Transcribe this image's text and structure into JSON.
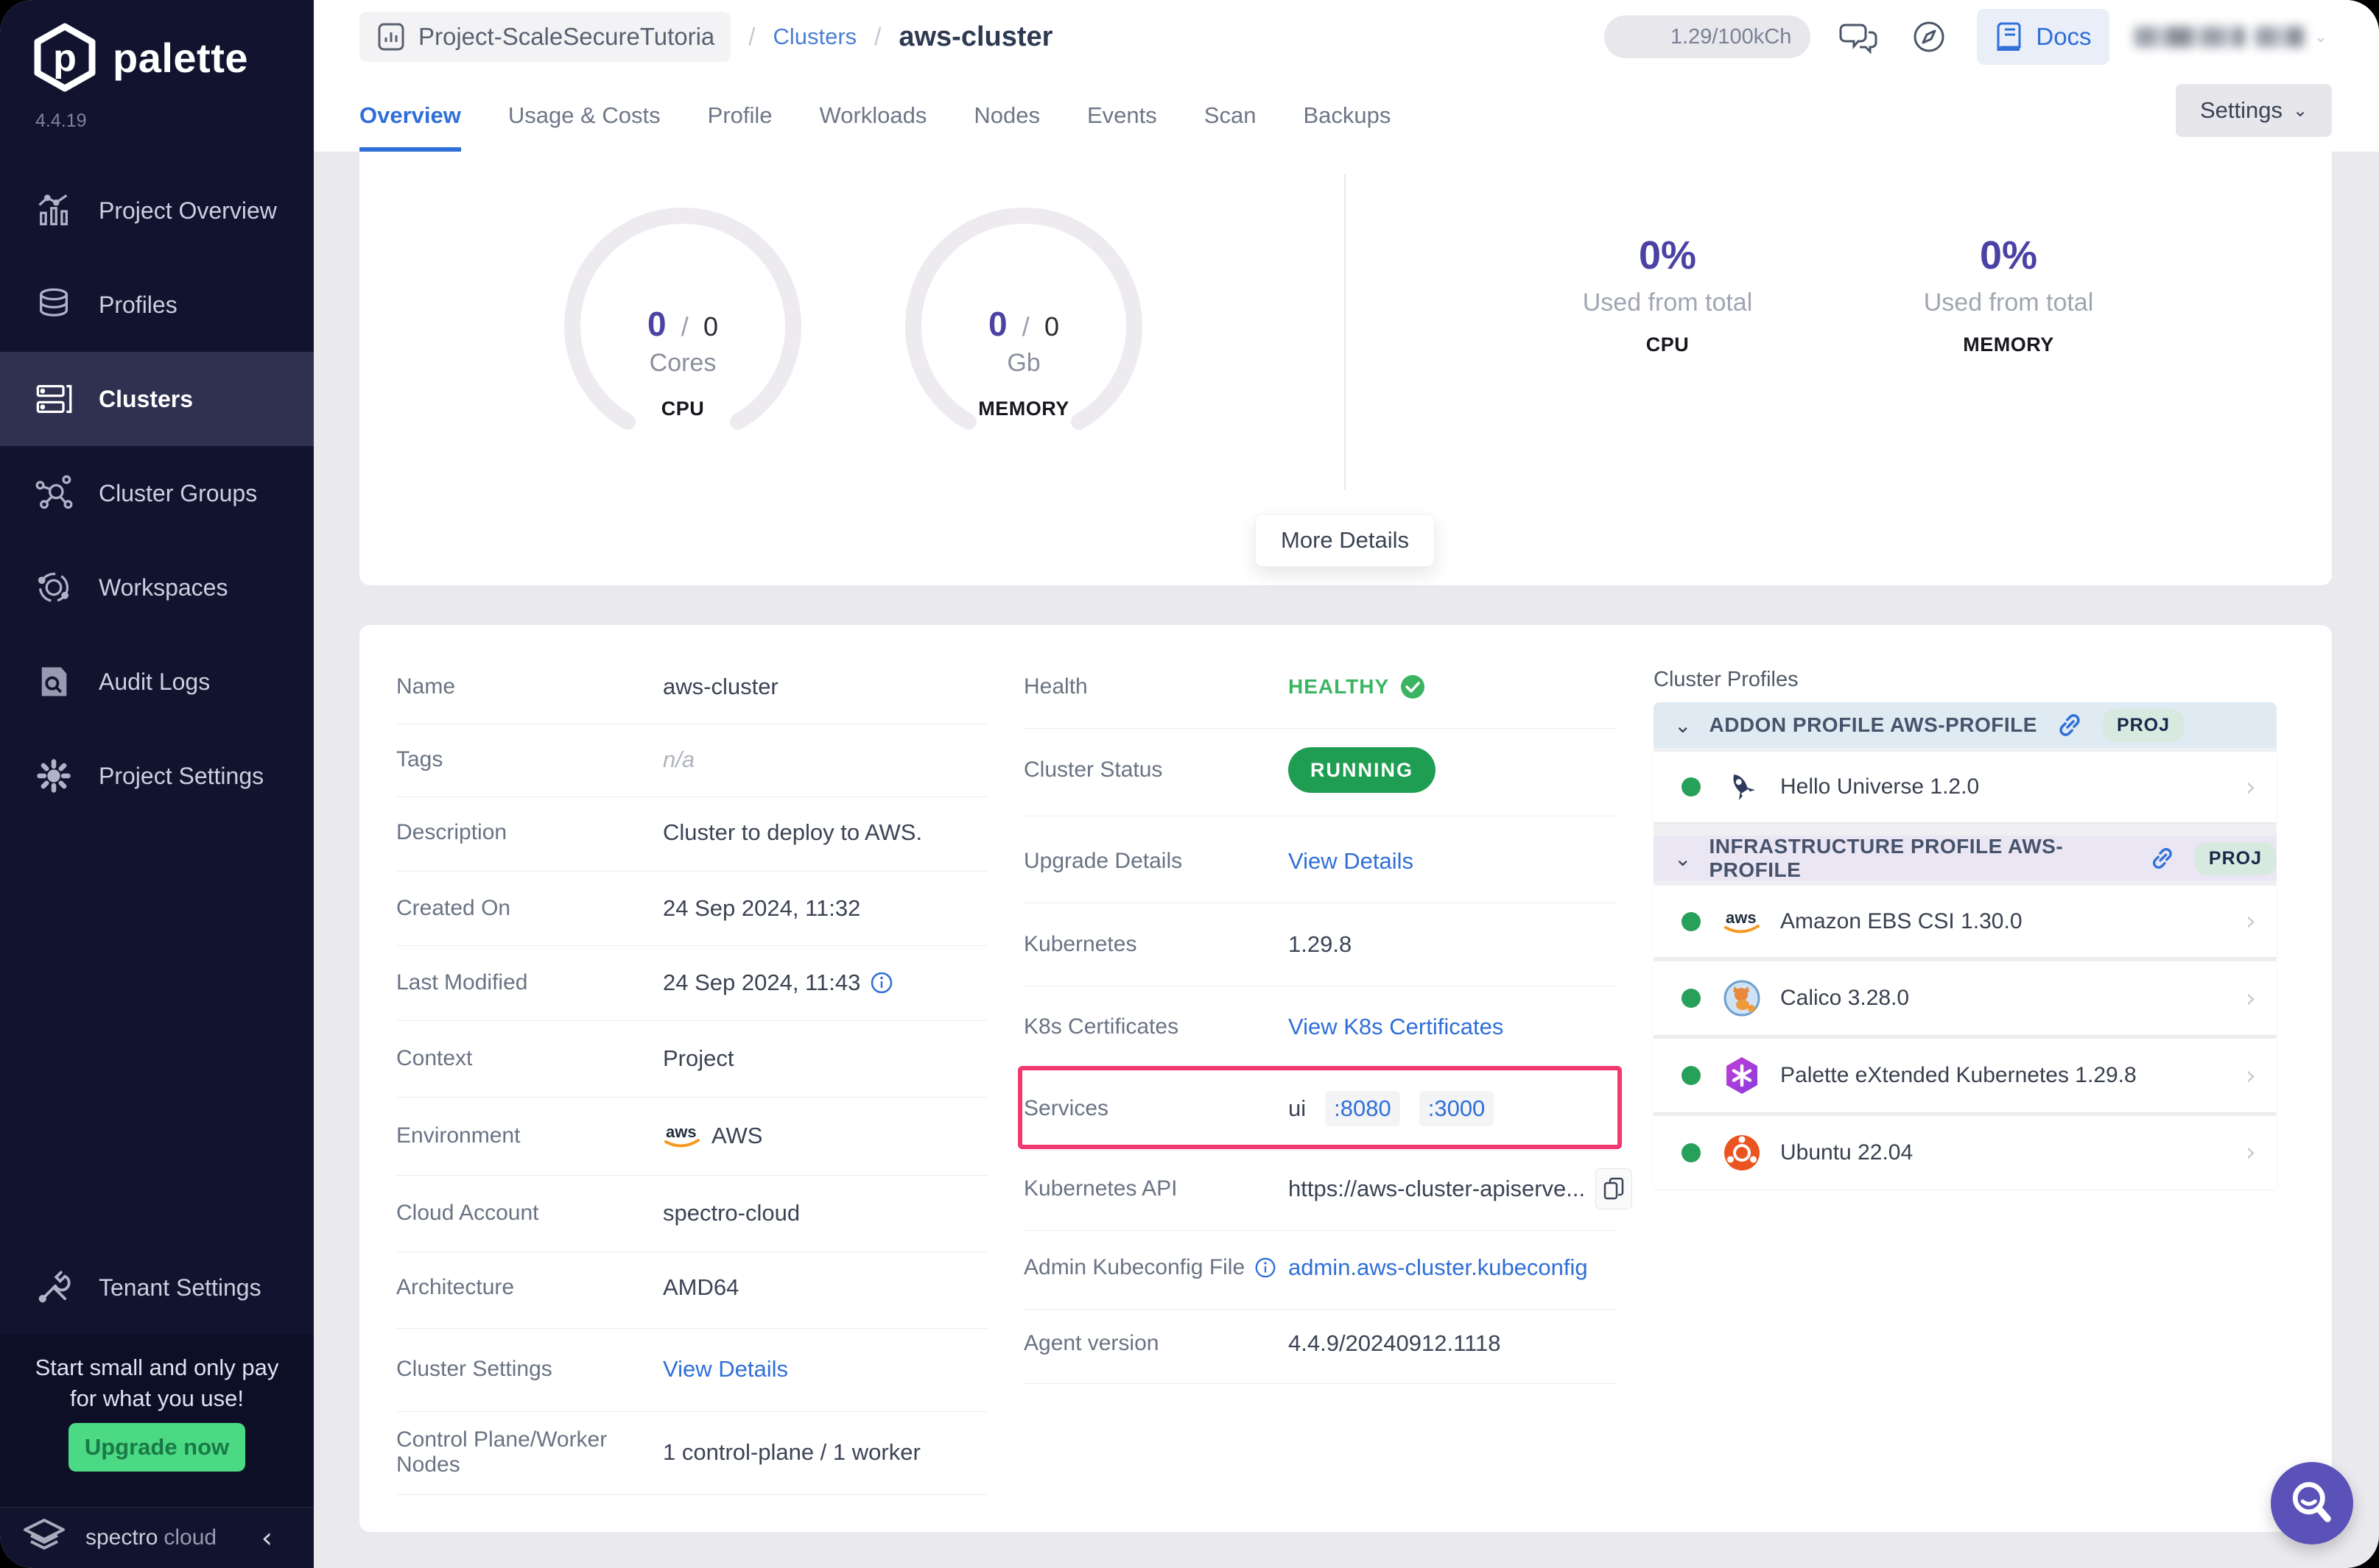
{
  "app": {
    "name": "palette",
    "version": "4.4.19"
  },
  "sidebar": {
    "items": [
      {
        "label": "Project Overview"
      },
      {
        "label": "Profiles"
      },
      {
        "label": "Clusters"
      },
      {
        "label": "Cluster Groups"
      },
      {
        "label": "Workspaces"
      },
      {
        "label": "Audit Logs"
      },
      {
        "label": "Project Settings"
      }
    ],
    "active_item": "Clusters",
    "tenant_settings": "Tenant Settings",
    "promo": {
      "line1": "Start small and only pay",
      "line2": "for what you use!",
      "button": "Upgrade now"
    },
    "footer": {
      "brand_first": "spectro",
      "brand_second": "cloud"
    }
  },
  "header": {
    "breadcrumb": {
      "project": "Project-ScaleSecureTutoria",
      "separator": "/",
      "section": "Clusters",
      "current": "aws-cluster"
    },
    "credits": "1.29/100kCh",
    "docs_label": "Docs",
    "settings_label": "Settings",
    "tabs": [
      {
        "label": "Overview"
      },
      {
        "label": "Usage & Costs"
      },
      {
        "label": "Profile"
      },
      {
        "label": "Workloads"
      },
      {
        "label": "Nodes"
      },
      {
        "label": "Events"
      },
      {
        "label": "Scan"
      },
      {
        "label": "Backups"
      }
    ],
    "active_tab": "Overview"
  },
  "metrics": {
    "separator": "/",
    "gauges": [
      {
        "value": "0",
        "total": "0",
        "unit": "Cores",
        "label": "CPU"
      },
      {
        "value": "0",
        "total": "0",
        "unit": "Gb",
        "label": "MEMORY"
      }
    ],
    "usage": [
      {
        "percent": "0%",
        "caption": "Used from total",
        "label": "CPU"
      },
      {
        "percent": "0%",
        "caption": "Used from total",
        "label": "MEMORY"
      }
    ],
    "more_details_label": "More Details"
  },
  "details": {
    "left": [
      {
        "label": "Name",
        "value": "aws-cluster"
      },
      {
        "label": "Tags",
        "value": "n/a"
      },
      {
        "label": "Description",
        "value": "Cluster to deploy to AWS."
      },
      {
        "label": "Created On",
        "value": "24 Sep 2024, 11:32"
      },
      {
        "label": "Last Modified",
        "value": "24 Sep 2024, 11:43"
      },
      {
        "label": "Context",
        "value": "Project"
      },
      {
        "label": "Environment",
        "value": "AWS"
      },
      {
        "label": "Cloud Account",
        "value": "spectro-cloud"
      },
      {
        "label": "Architecture",
        "value": "AMD64"
      },
      {
        "label": "Cluster Settings",
        "value": "View Details"
      },
      {
        "label": "Control Plane/Worker Nodes",
        "value": "1 control-plane / 1 worker"
      }
    ],
    "middle": [
      {
        "label": "Health",
        "value": "HEALTHY"
      },
      {
        "label": "Cluster Status",
        "value": "RUNNING"
      },
      {
        "label": "Upgrade Details",
        "value": "View Details"
      },
      {
        "label": "Kubernetes",
        "value": "1.29.8"
      },
      {
        "label": "K8s Certificates",
        "value": "View K8s Certificates"
      },
      {
        "label": "Services",
        "value": "ui",
        "ports": [
          ":8080",
          ":3000"
        ]
      },
      {
        "label": "Kubernetes API",
        "value": "https://aws-cluster-apiserve..."
      },
      {
        "label": "Admin Kubeconfig File",
        "value": "admin.aws-cluster.kubeconfig"
      },
      {
        "label": "Agent version",
        "value": "4.4.9/20240912.1118"
      }
    ]
  },
  "profiles": {
    "title": "Cluster Profiles",
    "groups": [
      {
        "name": "ADDON PROFILE AWS-PROFILE",
        "badge": "PROJ",
        "items": [
          {
            "name": "Hello Universe 1.2.0"
          }
        ]
      },
      {
        "name": "INFRASTRUCTURE PROFILE AWS-PROFILE",
        "badge": "PROJ",
        "items": [
          {
            "name": "Amazon EBS CSI 1.30.0"
          },
          {
            "name": "Calico 3.28.0"
          },
          {
            "name": "Palette eXtended Kubernetes 1.29.8"
          },
          {
            "name": "Ubuntu 22.04"
          }
        ]
      }
    ]
  },
  "colors": {
    "accent_purple": "#4B42A4",
    "link_blue": "#2F6FD8",
    "healthy_green": "#3CB563",
    "running_green": "#1F9D53",
    "status_dot_green": "#27A05A",
    "highlight_pink": "#F1386F",
    "sidebar_navy": "#12142F",
    "upgrade_green": "#4CD984"
  }
}
